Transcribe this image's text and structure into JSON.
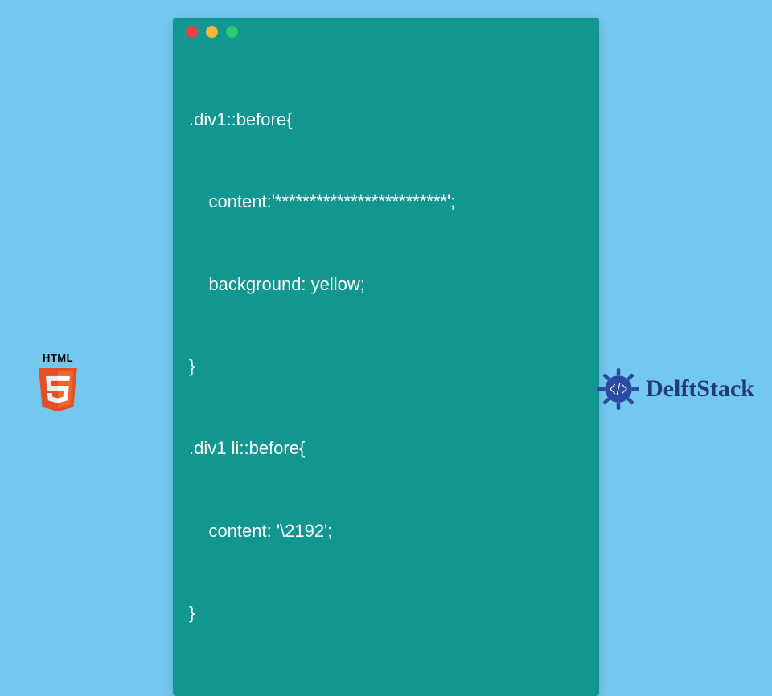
{
  "code": {
    "lines": [
      ".div1::before{",
      "    content:'*************************';",
      "    background: yellow;",
      "}",
      ".div1 li::before{",
      "    content: '\\2192';",
      "}"
    ]
  },
  "html5": {
    "label": "HTML"
  },
  "brand": {
    "name": "DelftStack"
  },
  "colors": {
    "bg": "#72c8ed",
    "window": "#129690",
    "dotRed": "#ed4245",
    "dotYellow": "#f6b93b",
    "dotGreen": "#2ecc71",
    "brandText": "#243a7a"
  }
}
